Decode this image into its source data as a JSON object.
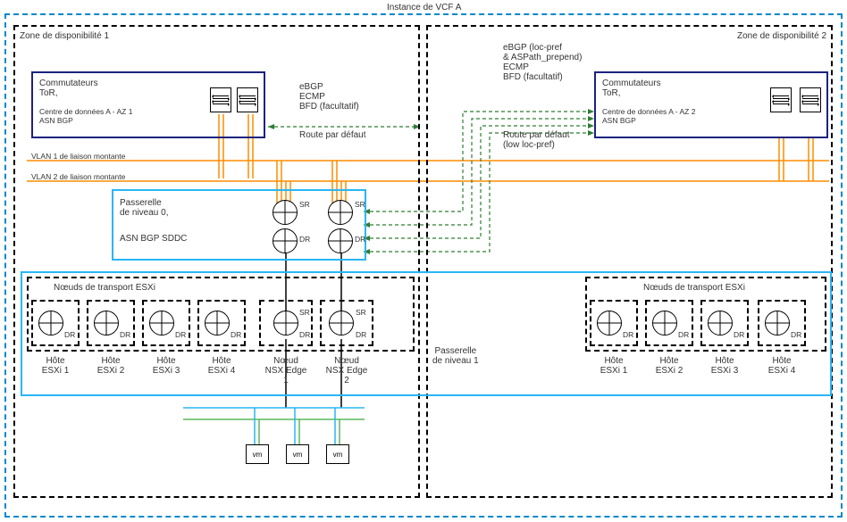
{
  "diagram": {
    "title": "Instance de VCF A",
    "az1": {
      "title": "Zone de disponibilité 1",
      "tor": {
        "title": "Commutateurs\nToR,",
        "subtitle": "Centre de données A - AZ 1\nASN BGP"
      },
      "vlan1": "VLAN 1 de liaison montante",
      "vlan2": "VLAN 2 de liaison montante",
      "tier0": {
        "title": "Passerelle\nde niveau 0,",
        "asn": "ASN BGP SDDC"
      },
      "sr": "SR",
      "dr": "DR",
      "transport_title": "Nœuds de transport ESXi",
      "hosts": [
        "Hôte\nESXi 1",
        "Hôte\nESXi 2",
        "Hôte\nESXi 3",
        "Hôte\nESXi 4"
      ],
      "edges": [
        "Nœud\nNSX Edge\n1",
        "Nœud\nNSX Edge\n2"
      ]
    },
    "az2": {
      "title": "Zone de disponibilité 2",
      "tor": {
        "title": "Commutateurs\nToR,",
        "subtitle": "Centre de données A - AZ 2\nASN BGP"
      },
      "transport_title": "Nœuds de transport ESXi",
      "hosts": [
        "Hôte\nESXi 1",
        "Hôte\nESXi 2",
        "Hôte\nESXi 3",
        "Hôte\nESXi 4"
      ]
    },
    "center": {
      "ebgp1": "eBGP\nECMP\nBFD (facultatif)",
      "route1": "Route par défaut",
      "ebgp2": "eBGP (loc-pref\n& ASPath_prepend)\nECMP\nBFD (facultatif)",
      "route2": "Route par défaut\n(low loc-pref)",
      "tier1": "Passerelle\nde niveau 1"
    },
    "vm": "vm"
  }
}
